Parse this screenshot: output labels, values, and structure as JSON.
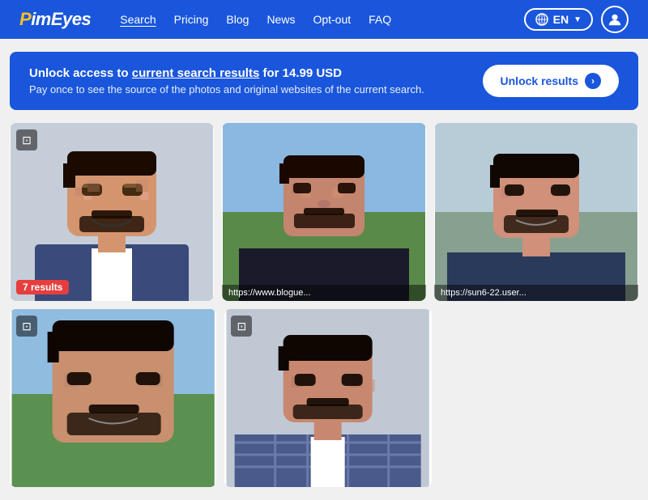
{
  "brand": {
    "name": "PimEyes",
    "name_styled": "PimEyes"
  },
  "nav": {
    "links": [
      {
        "label": "Search",
        "active": true
      },
      {
        "label": "Pricing",
        "active": false
      },
      {
        "label": "Blog",
        "active": false
      },
      {
        "label": "News",
        "active": false
      },
      {
        "label": "Opt-out",
        "active": false
      },
      {
        "label": "FAQ",
        "active": false
      }
    ],
    "lang": "EN",
    "lang_icon": "🌐"
  },
  "banner": {
    "prefix": "Unlock access to ",
    "link_text": "current search results",
    "suffix": " for 14.99 USD",
    "subtitle": "Pay once to see the source of the photos and original websites of the current search.",
    "button_label": "Unlock results"
  },
  "cards": [
    {
      "id": 1,
      "badge": "7 results",
      "has_badge": true,
      "has_icon": true,
      "url": null,
      "bg_color": "#b8c5d6",
      "face_type": 1
    },
    {
      "id": 2,
      "badge": null,
      "has_badge": false,
      "has_icon": false,
      "url": "https://www.blogue...",
      "bg_color": "#7a9e7e",
      "face_type": 2
    },
    {
      "id": 3,
      "badge": null,
      "has_badge": false,
      "has_icon": false,
      "url": "https://sun6-22.user...",
      "bg_color": "#c8d4dc",
      "face_type": 3
    },
    {
      "id": 4,
      "badge": null,
      "has_badge": false,
      "has_icon": true,
      "url": null,
      "bg_color": "#8aaa7a",
      "face_type": 4
    },
    {
      "id": 5,
      "badge": null,
      "has_badge": false,
      "has_icon": true,
      "url": null,
      "bg_color": "#b0b8c8",
      "face_type": 5
    }
  ]
}
